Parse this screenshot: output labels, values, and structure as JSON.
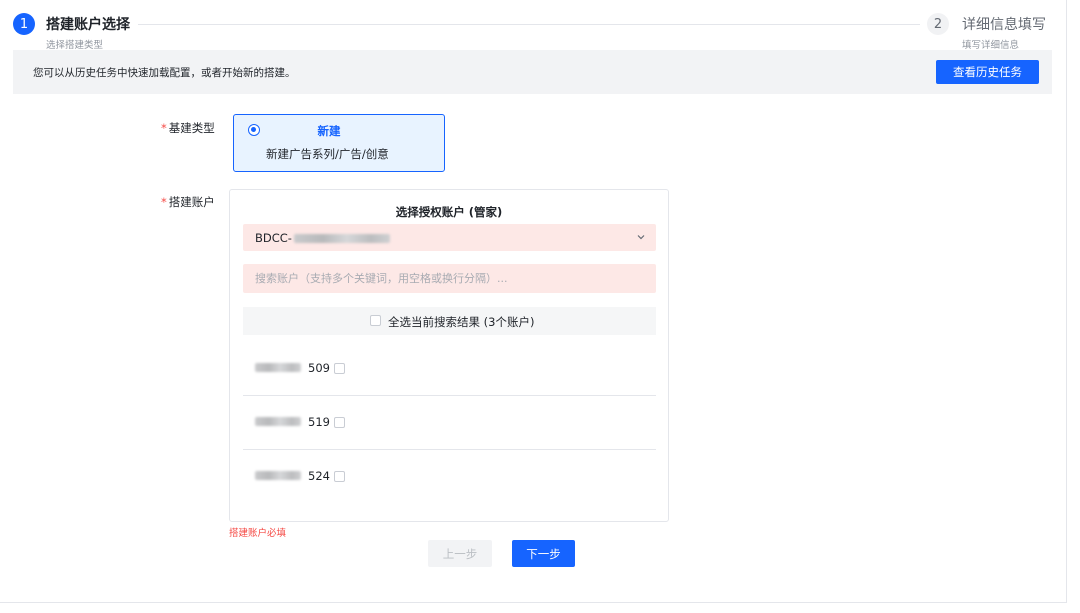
{
  "stepper": {
    "steps": [
      {
        "number": "1",
        "title": "搭建账户选择",
        "subtitle": "选择搭建类型"
      },
      {
        "number": "2",
        "title": "详细信息填写",
        "subtitle": "填写详细信息"
      }
    ]
  },
  "notice": {
    "text": "您可以从历史任务中快速加载配置，或者开始新的搭建。",
    "history_button": "查看历史任务"
  },
  "form": {
    "required_mark": "*",
    "type_label": "基建类型",
    "type_option": {
      "title": "新建",
      "description": "新建广告系列/广告/创意"
    },
    "account_label": "搭建账户",
    "account_panel": {
      "title": "选择授权账户 (管家)",
      "selected_account_prefix": "BDCC-",
      "search_placeholder": "搜索账户（支持多个关键词，用空格或换行分隔）...",
      "select_all_label": "全选当前搜索结果 (3个账户)",
      "accounts": [
        {
          "suffix": "509"
        },
        {
          "suffix": "519"
        },
        {
          "suffix": "524"
        }
      ]
    },
    "error_message": "搭建账户必填"
  },
  "footer": {
    "prev_button": "上一步",
    "next_button": "下一步"
  },
  "colors": {
    "primary": "#1664ff",
    "error": "#f54a45",
    "error_bg": "#fde8e6",
    "selected_card_bg": "#e8f3ff"
  },
  "icons": [
    "radio-selected-icon",
    "chevron-down-icon",
    "checkbox-icon"
  ]
}
